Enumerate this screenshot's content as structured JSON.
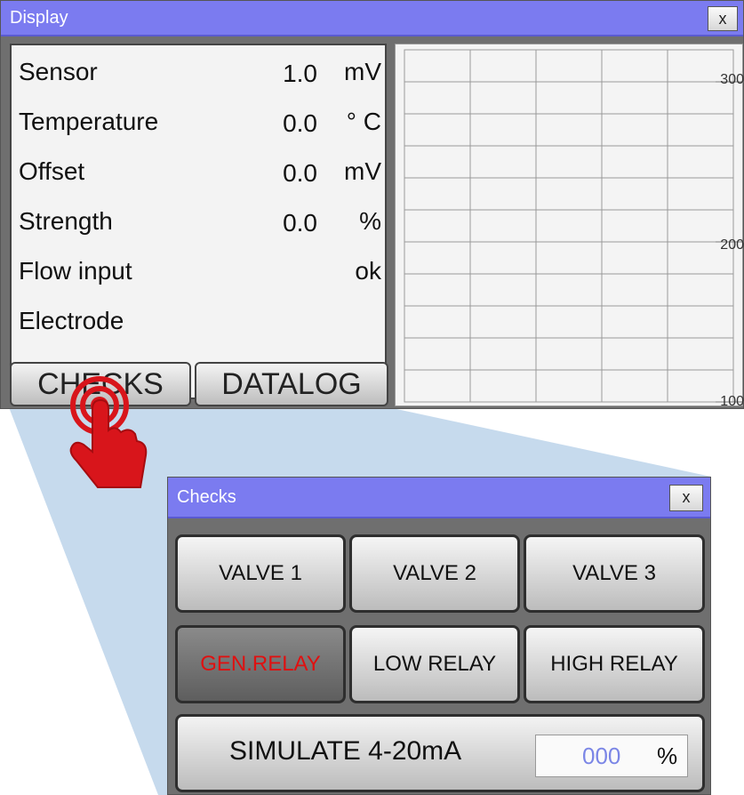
{
  "display_window": {
    "title": "Display",
    "close_label": "x",
    "readings": [
      {
        "label": "Sensor",
        "value": "1.0",
        "unit": "mV"
      },
      {
        "label": "Temperature",
        "value": "0.0",
        "unit": "° C"
      },
      {
        "label": "Offset",
        "value": "0.0",
        "unit": "mV"
      },
      {
        "label": "Strength",
        "value": "0.0",
        "unit": "%"
      },
      {
        "label": "Flow input",
        "value": "",
        "unit": "ok"
      },
      {
        "label": "Electrode",
        "value": "",
        "unit": ""
      }
    ],
    "tabs": [
      {
        "label": "CHECKS"
      },
      {
        "label": "DATALOG"
      }
    ],
    "chart": {
      "y_ticks": [
        "300",
        "200",
        "100"
      ]
    }
  },
  "checks_window": {
    "title": "Checks",
    "close_label": "x",
    "buttons": [
      {
        "label": "VALVE 1",
        "active": false
      },
      {
        "label": "VALVE 2",
        "active": false
      },
      {
        "label": "VALVE 3",
        "active": false
      },
      {
        "label": "GEN.RELAY",
        "active": true
      },
      {
        "label": "LOW RELAY",
        "active": false
      },
      {
        "label": "HIGH RELAY",
        "active": false
      }
    ],
    "simulate": {
      "label": "SIMULATE 4-20mA",
      "value": "000",
      "unit": "%"
    }
  },
  "colors": {
    "titlebar": "#7b7bf0",
    "active_text": "#e01010",
    "value_text": "#7b86e6",
    "funnel": "#bcd3ea",
    "hand": "#d8151b"
  },
  "icons": {
    "pointer": "hand-tap-icon"
  }
}
